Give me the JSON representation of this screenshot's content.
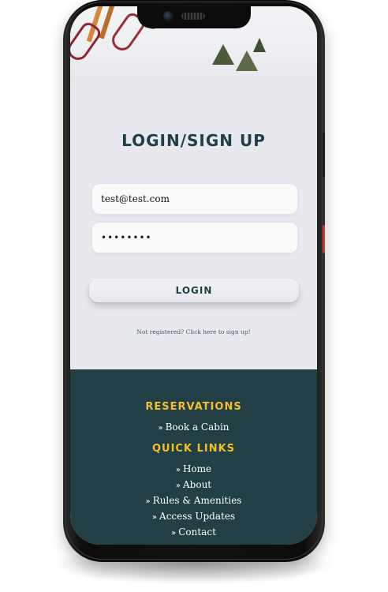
{
  "login": {
    "title": "LOGIN/SIGN UP",
    "email_value": "test@test.com",
    "password_value": "••••••••",
    "login_button": "LOGIN",
    "signup_link": "Not registered? Click here to sign up!"
  },
  "footer": {
    "reservations_heading": "RESERVATIONS",
    "reservations_links": [
      {
        "label": "Book a Cabin"
      }
    ],
    "quick_links_heading": "QUICK LINKS",
    "quick_links": [
      {
        "label": "Home"
      },
      {
        "label": "About"
      },
      {
        "label": "Rules & Amenities"
      },
      {
        "label": "Access Updates"
      },
      {
        "label": "Contact"
      }
    ],
    "link_icon": "double-chevron-right-icon"
  },
  "colors": {
    "primary_text": "#1f4047",
    "footer_bg": "#213f44",
    "accent_yellow": "#f3bf2a",
    "page_bg": "#e7e9ee"
  }
}
